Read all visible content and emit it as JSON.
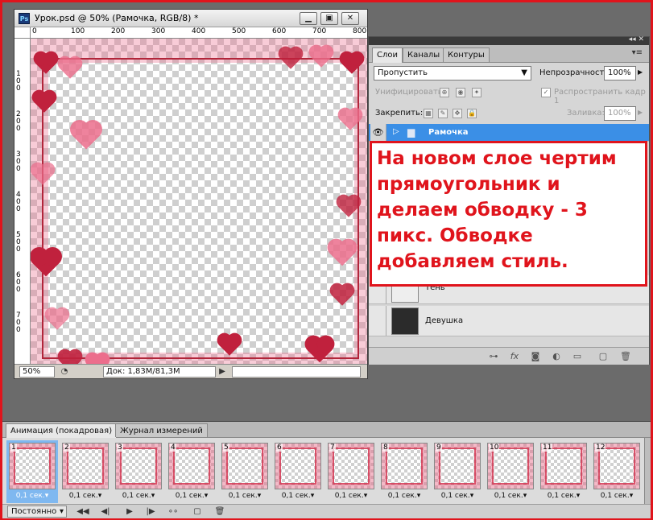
{
  "document": {
    "title": "Урок.psd @ 50% (Рамочка, RGB/8) *",
    "ps_icon": "Ps",
    "window_buttons": [
      "minimize-icon",
      "restore-icon",
      "close-icon"
    ],
    "ruler_top": [
      "0",
      "100",
      "200",
      "300",
      "400",
      "500",
      "600",
      "700",
      "800"
    ],
    "ruler_left": [
      "100",
      "200",
      "300",
      "400",
      "500",
      "600",
      "700"
    ],
    "zoom": "50%",
    "doc_size": "Док: 1,83M/81,3M"
  },
  "layers_panel": {
    "tabs": [
      {
        "label": "Слои",
        "active": true
      },
      {
        "label": "Каналы",
        "active": false
      },
      {
        "label": "Контуры",
        "active": false
      }
    ],
    "blend_mode": "Пропустить",
    "opacity_label": "Непрозрачность:",
    "opacity_value": "100%",
    "unify_label": "Унифицировать:",
    "propagate_label": "Распространить кадр 1",
    "lock_label": "Закрепить:",
    "fill_label": "Заливка:",
    "fill_value": "100%",
    "layers": [
      {
        "name": "Рамочка",
        "selected": true,
        "visible": true,
        "kind": "folder"
      },
      {
        "name": "Тень",
        "selected": false,
        "visible": false,
        "kind": "layer"
      },
      {
        "name": "Девушка",
        "selected": false,
        "visible": false,
        "kind": "layer"
      }
    ]
  },
  "callout": {
    "text": "На новом слое чертим прямоугольник и делаем обводку  - 3 пикс. Обводке добавляем стиль."
  },
  "animation_panel": {
    "tabs": [
      {
        "label": "Анимация (покадровая)",
        "active": true
      },
      {
        "label": "Журнал измерений",
        "active": false
      }
    ],
    "frames": [
      {
        "number": "1",
        "delay": "0,1 сек."
      },
      {
        "number": "2",
        "delay": "0,1 сек."
      },
      {
        "number": "3",
        "delay": "0,1 сек."
      },
      {
        "number": "4",
        "delay": "0,1 сек."
      },
      {
        "number": "5",
        "delay": "0,1 сек."
      },
      {
        "number": "6",
        "delay": "0,1 сек."
      },
      {
        "number": "7",
        "delay": "0,1 сек."
      },
      {
        "number": "8",
        "delay": "0,1 сек."
      },
      {
        "number": "9",
        "delay": "0,1 сек."
      },
      {
        "number": "10",
        "delay": "0,1 сек."
      },
      {
        "number": "11",
        "delay": "0,1 сек."
      },
      {
        "number": "12",
        "delay": "0,1 сек."
      }
    ],
    "selected_frame": "1",
    "loop": "Постоянно"
  },
  "colors": {
    "accent_red": "#e0141c",
    "selection_blue": "#3b8fe6",
    "heart_red": "#c0213d",
    "heart_pink": "#ec6e8c"
  }
}
